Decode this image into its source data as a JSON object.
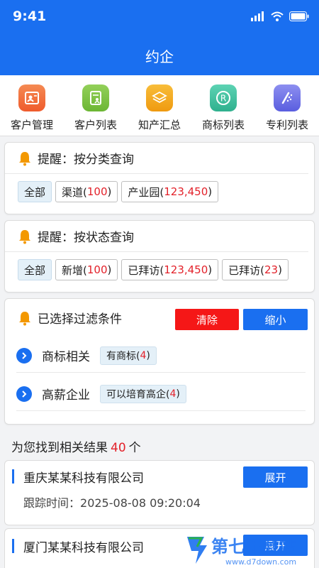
{
  "status_bar": {
    "time": "9:41"
  },
  "app": {
    "title": "约企"
  },
  "quick_nav": [
    {
      "label": "客户管理",
      "icon": "id-card-icon",
      "color": "#f26b3a"
    },
    {
      "label": "客户列表",
      "icon": "contact-list-icon",
      "color": "#7cc043"
    },
    {
      "label": "知产汇总",
      "icon": "layers-icon",
      "color": "#f3a51d"
    },
    {
      "label": "商标列表",
      "icon": "registered-trademark-icon",
      "color": "#3ec1a2"
    },
    {
      "label": "专利列表",
      "icon": "patent-icon",
      "color": "#6b6fe8"
    }
  ],
  "category_card": {
    "title": "提醒：按分类查询",
    "chips": [
      {
        "label": "全部",
        "count": ""
      },
      {
        "label": "渠道(",
        "count": "100",
        "suffix": ")"
      },
      {
        "label": "产业园(",
        "count": "123,450",
        "suffix": ")"
      }
    ]
  },
  "status_card": {
    "title": "提醒：按状态查询",
    "chips": [
      {
        "label": "全部",
        "count": ""
      },
      {
        "label": "新增(",
        "count": "100",
        "suffix": ")"
      },
      {
        "label": "已拜访(",
        "count": "123,450",
        "suffix": ")"
      },
      {
        "label": "已拜访(",
        "count": "23",
        "suffix": ")"
      }
    ]
  },
  "filter_card": {
    "title": "已选择过滤条件",
    "clear_label": "清除",
    "collapse_label": "缩小",
    "filters": [
      {
        "name": "商标相关",
        "chip": "有商标(",
        "count": "4",
        "suffix": ")"
      },
      {
        "name": "高薪企业",
        "chip": "可以培育高企(",
        "count": "4",
        "suffix": ")"
      }
    ]
  },
  "results": {
    "prefix": "为您找到相关结果",
    "count": "40",
    "suffix": "个",
    "items": [
      {
        "company": "重庆某某科技有限公司",
        "track_label": "跟踪时间：",
        "track_time": "2025-08-08 09:20:04",
        "expand_label": "展开"
      },
      {
        "company": "厦门某某科技有限公司",
        "expand_label": "展开"
      }
    ]
  },
  "watermark": {
    "text": "第七下载站",
    "sub": "www.d7down.com"
  },
  "colors": {
    "primary": "#1a6ff0",
    "danger": "#f51717",
    "accent_red": "#e3212a",
    "bell": "#f39800"
  }
}
